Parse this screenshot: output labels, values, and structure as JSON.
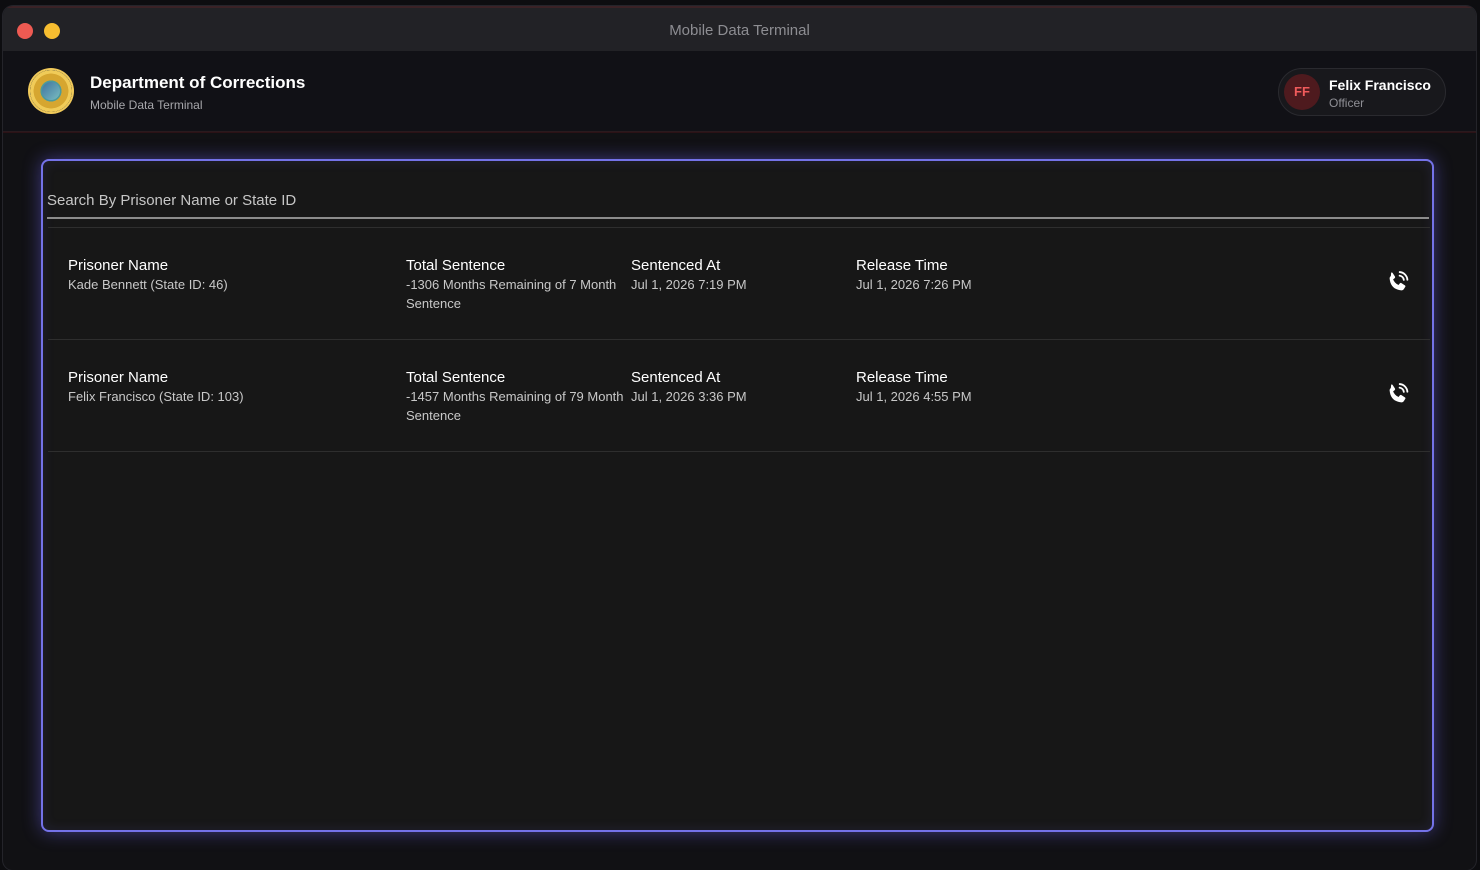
{
  "window": {
    "title": "Mobile Data Terminal"
  },
  "header": {
    "org_title": "Department of Corrections",
    "org_subtitle": "Mobile Data Terminal",
    "user": {
      "initials": "FF",
      "name": "Felix Francisco",
      "role": "Officer"
    }
  },
  "search": {
    "placeholder": "Search By Prisoner Name or State ID",
    "value": ""
  },
  "columns": {
    "name_label": "Prisoner Name",
    "sentence_label": "Total Sentence",
    "sentenced_at_label": "Sentenced At",
    "release_label": "Release Time"
  },
  "records": [
    {
      "name": "Kade Bennett (State ID: 46)",
      "sentence": "-1306 Months Remaining of 7 Month Sentence",
      "sentenced_at": "Jul 1, 2026 7:19 PM",
      "release_time": "Jul 1, 2026 7:26 PM",
      "action_icon": "phone-call-icon"
    },
    {
      "name": "Felix Francisco (State ID: 103)",
      "sentence": "-1457 Months Remaining of 79 Month Sentence",
      "sentenced_at": "Jul 1, 2026 3:36 PM",
      "release_time": "Jul 1, 2026 4:55 PM",
      "action_icon": "phone-call-icon"
    }
  ],
  "colors": {
    "accent": "#7472e8",
    "background": "#171717",
    "avatar_bg": "#4e1a1e",
    "avatar_text": "#ef5b5b"
  }
}
